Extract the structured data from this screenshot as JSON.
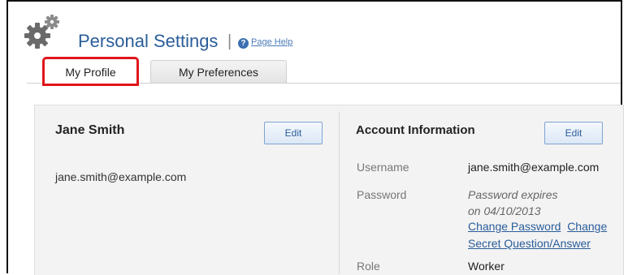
{
  "header": {
    "title": "Personal Settings",
    "separator": "|",
    "help_icon_glyph": "?",
    "help_link": "Page Help"
  },
  "tabs": [
    {
      "label": "My Profile",
      "active": true
    },
    {
      "label": "My Preferences",
      "active": false
    }
  ],
  "profile": {
    "name": "Jane Smith",
    "email": "jane.smith@example.com",
    "edit_label": "Edit"
  },
  "account": {
    "title": "Account Information",
    "edit_label": "Edit",
    "username_label": "Username",
    "username_value": "jane.smith@example.com",
    "password_label": "Password",
    "password_expires_line1": "Password expires",
    "password_expires_line2": "on 04/10/2013",
    "change_password_link": "Change Password",
    "change_secret_link_part1": "Change",
    "change_secret_link_part2": "Secret Question/Answer",
    "role_label": "Role",
    "role_value": "Worker"
  },
  "colors": {
    "accent": "#2a5d9a",
    "highlight": "#e0151a"
  },
  "icons": {
    "settings": "gear-icon",
    "help": "help-icon"
  }
}
